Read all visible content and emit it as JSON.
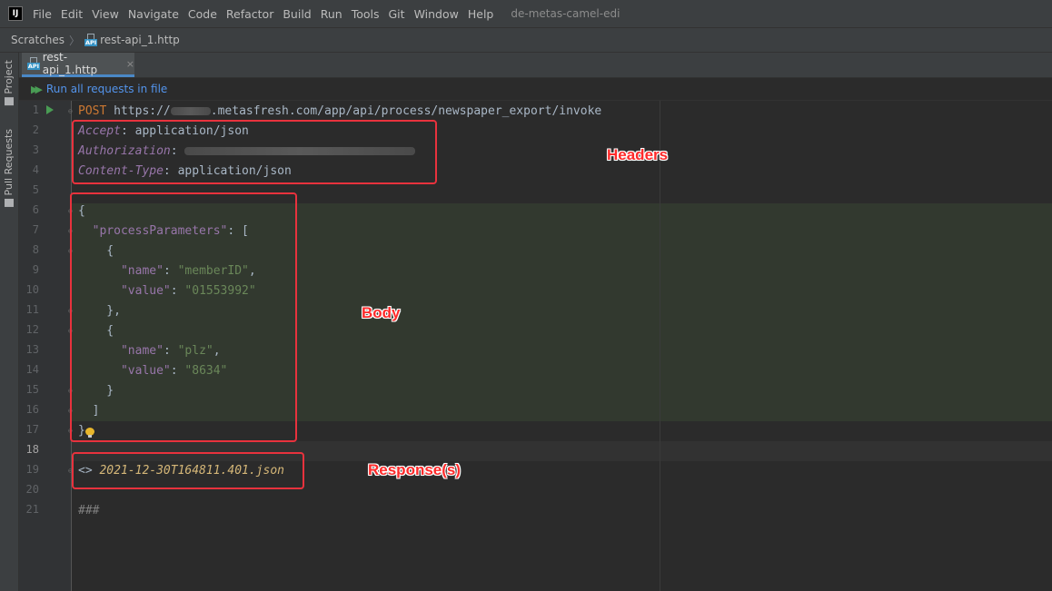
{
  "menubar": {
    "items": [
      "File",
      "Edit",
      "View",
      "Navigate",
      "Code",
      "Refactor",
      "Build",
      "Run",
      "Tools",
      "Git",
      "Window",
      "Help"
    ],
    "project": "de-metas-camel-edi"
  },
  "breadcrumb": {
    "root": "Scratches",
    "file": "rest-api_1.http"
  },
  "sidebar": {
    "project_tab": "Project",
    "pull_requests_tab": "Pull Requests"
  },
  "tab": {
    "label": "rest-api_1.http",
    "close": "×"
  },
  "toolbar": {
    "run_all": "Run all requests in file"
  },
  "editor": {
    "line_numbers": [
      "1",
      "2",
      "3",
      "4",
      "5",
      "6",
      "7",
      "8",
      "9",
      "10",
      "11",
      "12",
      "13",
      "14",
      "15",
      "16",
      "17",
      "18",
      "19",
      "20",
      "21"
    ],
    "request": {
      "method": "POST",
      "url_prefix": "https://",
      "url_suffix": ".metasfresh.com/app/api/process/newspaper_export/invoke"
    },
    "headers": [
      {
        "name": "Accept",
        "value": "application/json"
      },
      {
        "name": "Authorization",
        "value": ""
      },
      {
        "name": "Content-Type",
        "value": "application/json"
      }
    ],
    "body": {
      "key": "\"processParameters\"",
      "params": [
        {
          "name_key": "\"name\"",
          "name_val": "\"memberID\"",
          "value_key": "\"value\"",
          "value_val": "\"01553992\""
        },
        {
          "name_key": "\"name\"",
          "name_val": "\"plz\"",
          "value_key": "\"value\"",
          "value_val": "\"8634\""
        }
      ]
    },
    "response_marker": "<>",
    "response_file": "2021-12-30T164811.401.json",
    "separator": "###"
  },
  "annotations": {
    "headers": "Headers",
    "body": "Body",
    "responses": "Response(s)",
    "color": "#e8323d"
  }
}
